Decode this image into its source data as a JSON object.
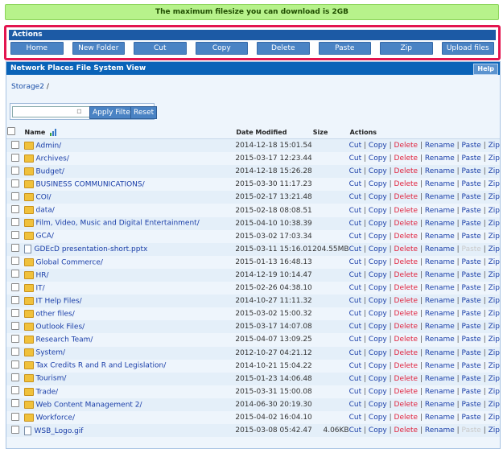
{
  "banner": "The maximum filesize you can download is 2GB",
  "actions": {
    "title": "Actions",
    "buttons": [
      "Home",
      "New Folder",
      "Cut",
      "Copy",
      "Delete",
      "Paste",
      "Zip",
      "Upload files"
    ]
  },
  "panel": {
    "title": "Network Places File System View",
    "help": "Help"
  },
  "breadcrumb": {
    "path": "Storage2",
    "sep": "/"
  },
  "filter": {
    "value": "",
    "apply": "Apply Filter",
    "reset": "Reset"
  },
  "table": {
    "headers": {
      "name": "Name",
      "date": "Date Modified",
      "size": "Size",
      "actions": "Actions"
    },
    "action_labels": {
      "cut": "Cut",
      "copy": "Copy",
      "delete": "Delete",
      "rename": "Rename",
      "paste": "Paste",
      "zip": "Zip"
    },
    "rows": [
      {
        "name": "Admin/",
        "date": "2014-12-18 15:01.54",
        "size": "",
        "type": "folder"
      },
      {
        "name": "Archives/",
        "date": "2015-03-17 12:23.44",
        "size": "",
        "type": "folder"
      },
      {
        "name": "Budget/",
        "date": "2014-12-18 15:26.28",
        "size": "",
        "type": "folder"
      },
      {
        "name": "BUSINESS COMMUNICATIONS/",
        "date": "2015-03-30 11:17.23",
        "size": "",
        "type": "folder"
      },
      {
        "name": "COI/",
        "date": "2015-02-17 13:21.48",
        "size": "",
        "type": "folder"
      },
      {
        "name": "data/",
        "date": "2015-02-18 08:08.51",
        "size": "",
        "type": "folder"
      },
      {
        "name": "Film, Video, Music and Digital Entertainment/",
        "date": "2015-04-10 10:38.39",
        "size": "",
        "type": "folder"
      },
      {
        "name": "GCA/",
        "date": "2015-03-02 17:03.34",
        "size": "",
        "type": "folder"
      },
      {
        "name": "GDEcD presentation-short.pptx",
        "date": "2015-03-11 15:16.01",
        "size": "204.55MB",
        "type": "file"
      },
      {
        "name": "Global Commerce/",
        "date": "2015-01-13 16:48.13",
        "size": "",
        "type": "folder"
      },
      {
        "name": "HR/",
        "date": "2014-12-19 10:14.47",
        "size": "",
        "type": "folder"
      },
      {
        "name": "IT/",
        "date": "2015-02-26 04:38.10",
        "size": "",
        "type": "folder"
      },
      {
        "name": "IT Help Files/",
        "date": "2014-10-27 11:11.32",
        "size": "",
        "type": "folder"
      },
      {
        "name": "other files/",
        "date": "2015-03-02 15:00.32",
        "size": "",
        "type": "folder"
      },
      {
        "name": "Outlook Files/",
        "date": "2015-03-17 14:07.08",
        "size": "",
        "type": "folder"
      },
      {
        "name": "Research Team/",
        "date": "2015-04-07 13:09.25",
        "size": "",
        "type": "folder"
      },
      {
        "name": "System/",
        "date": "2012-10-27 04:21.12",
        "size": "",
        "type": "folder"
      },
      {
        "name": "Tax Credits R and R and Legislation/",
        "date": "2014-10-21 15:04.22",
        "size": "",
        "type": "folder"
      },
      {
        "name": "Tourism/",
        "date": "2015-01-23 14:06.48",
        "size": "",
        "type": "folder"
      },
      {
        "name": "Trade/",
        "date": "2015-03-31 15:00.08",
        "size": "",
        "type": "folder"
      },
      {
        "name": "Web Content Management 2/",
        "date": "2014-06-30 20:19.30",
        "size": "",
        "type": "folder"
      },
      {
        "name": "Workforce/",
        "date": "2015-04-02 16:04.10",
        "size": "",
        "type": "folder"
      },
      {
        "name": "WSB_Logo.gif",
        "date": "2015-03-08 05:42.47",
        "size": "4.06KB",
        "type": "file"
      }
    ]
  }
}
